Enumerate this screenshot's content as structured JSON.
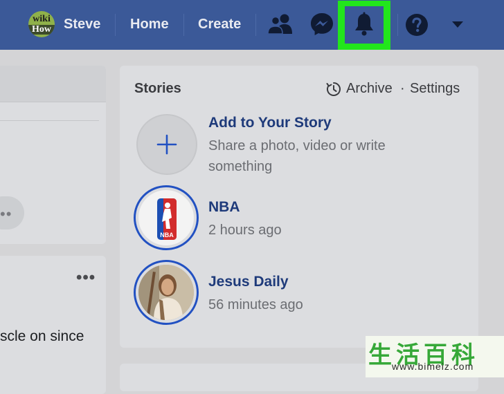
{
  "topbar": {
    "logo_line1": "wiki",
    "logo_line2": "How",
    "profile_name": "Steve",
    "home_label": "Home",
    "create_label": "Create",
    "bg_color": "#3b5998",
    "highlight_color": "#22e61c"
  },
  "left_feed": {
    "post_text": "scle on since"
  },
  "stories": {
    "title": "Stories",
    "archive_label": "Archive",
    "separator": "·",
    "settings_label": "Settings",
    "add_story": {
      "title": "Add to Your Story",
      "subtitle_line1": "Share a photo, video or write",
      "subtitle_line2": "something"
    },
    "items": [
      {
        "name": "NBA",
        "time": "2 hours ago",
        "avatar_text": "NBA"
      },
      {
        "name": "Jesus Daily",
        "time": "56 minutes ago"
      }
    ],
    "accent_color": "#2251c2"
  },
  "watermark": {
    "chars": "生活百科",
    "url": "www.bimeiz.com"
  }
}
